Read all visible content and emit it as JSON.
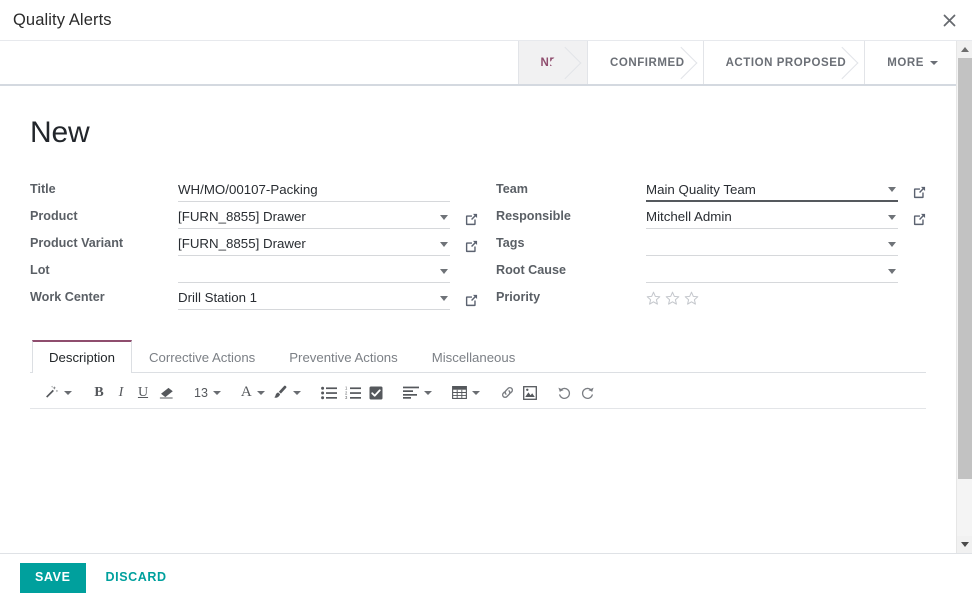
{
  "dialog": {
    "title": "Quality Alerts",
    "close_icon": "close-icon"
  },
  "statusbar": {
    "stages": [
      {
        "label": "NEW",
        "active": true
      },
      {
        "label": "CONFIRMED",
        "active": false
      },
      {
        "label": "ACTION PROPOSED",
        "active": false
      }
    ],
    "more_label": "MORE",
    "active_color": "#8f4d6e"
  },
  "record": {
    "title": "New"
  },
  "form": {
    "left": [
      {
        "label": "Title",
        "value": "WH/MO/00107-Packing",
        "widget": "char",
        "dropdown": false,
        "external_link": false,
        "focused": false
      },
      {
        "label": "Product",
        "value": "[FURN_8855] Drawer",
        "widget": "many2one",
        "dropdown": true,
        "external_link": true,
        "focused": false
      },
      {
        "label": "Product Variant",
        "value": "[FURN_8855] Drawer",
        "widget": "many2one",
        "dropdown": true,
        "external_link": true,
        "focused": false
      },
      {
        "label": "Lot",
        "value": "",
        "widget": "many2one",
        "dropdown": true,
        "external_link": false,
        "focused": false
      },
      {
        "label": "Work Center",
        "value": "Drill Station 1",
        "widget": "many2one",
        "dropdown": true,
        "external_link": true,
        "focused": false
      }
    ],
    "right": [
      {
        "label": "Team",
        "value": "Main Quality Team",
        "widget": "many2one",
        "dropdown": true,
        "external_link": true,
        "focused": true
      },
      {
        "label": "Responsible",
        "value": "Mitchell Admin",
        "widget": "many2one",
        "dropdown": true,
        "external_link": true,
        "focused": false
      },
      {
        "label": "Tags",
        "value": "",
        "widget": "many2many",
        "dropdown": true,
        "external_link": false,
        "focused": false
      },
      {
        "label": "Root Cause",
        "value": "",
        "widget": "many2one",
        "dropdown": true,
        "external_link": false,
        "focused": false
      }
    ],
    "priority": {
      "label": "Priority",
      "stars_total": 3,
      "stars_filled": 0,
      "star_glyph": "☆"
    }
  },
  "notebook": {
    "tabs": [
      {
        "label": "Description",
        "active": true
      },
      {
        "label": "Corrective Actions",
        "active": false
      },
      {
        "label": "Preventive Actions",
        "active": false
      },
      {
        "label": "Miscellaneous",
        "active": false
      }
    ],
    "active_tab_border_color": "#8f4d6e"
  },
  "editor": {
    "font_size_value": "13",
    "content": "",
    "buttons": [
      {
        "name": "style-wand-icon",
        "glyph": "✐",
        "caret": true
      },
      {
        "name": "bold-icon",
        "glyph": "B",
        "caret": false
      },
      {
        "name": "italic-icon",
        "glyph": "I",
        "caret": false
      },
      {
        "name": "underline-icon",
        "glyph": "U",
        "caret": false
      },
      {
        "name": "remove-format-eraser-icon",
        "glyph": "",
        "caret": false
      },
      {
        "name": "font-size-selector",
        "glyph": "13",
        "caret": true
      },
      {
        "name": "font-color-icon",
        "glyph": "A",
        "caret": true
      },
      {
        "name": "background-color-brush-icon",
        "glyph": "",
        "caret": true
      },
      {
        "name": "unordered-list-icon",
        "glyph": "",
        "caret": false
      },
      {
        "name": "ordered-list-icon",
        "glyph": "",
        "caret": false
      },
      {
        "name": "checklist-icon",
        "glyph": "",
        "caret": false
      },
      {
        "name": "align-left-icon",
        "glyph": "",
        "caret": true
      },
      {
        "name": "table-icon",
        "glyph": "",
        "caret": true
      },
      {
        "name": "link-icon",
        "glyph": "",
        "caret": false
      },
      {
        "name": "image-icon",
        "glyph": "",
        "caret": false
      },
      {
        "name": "undo-icon",
        "glyph": "",
        "caret": false
      },
      {
        "name": "redo-icon",
        "glyph": "",
        "caret": false
      }
    ]
  },
  "footer": {
    "save_label": "SAVE",
    "discard_label": "DISCARD",
    "save_color": "#00a09d"
  }
}
